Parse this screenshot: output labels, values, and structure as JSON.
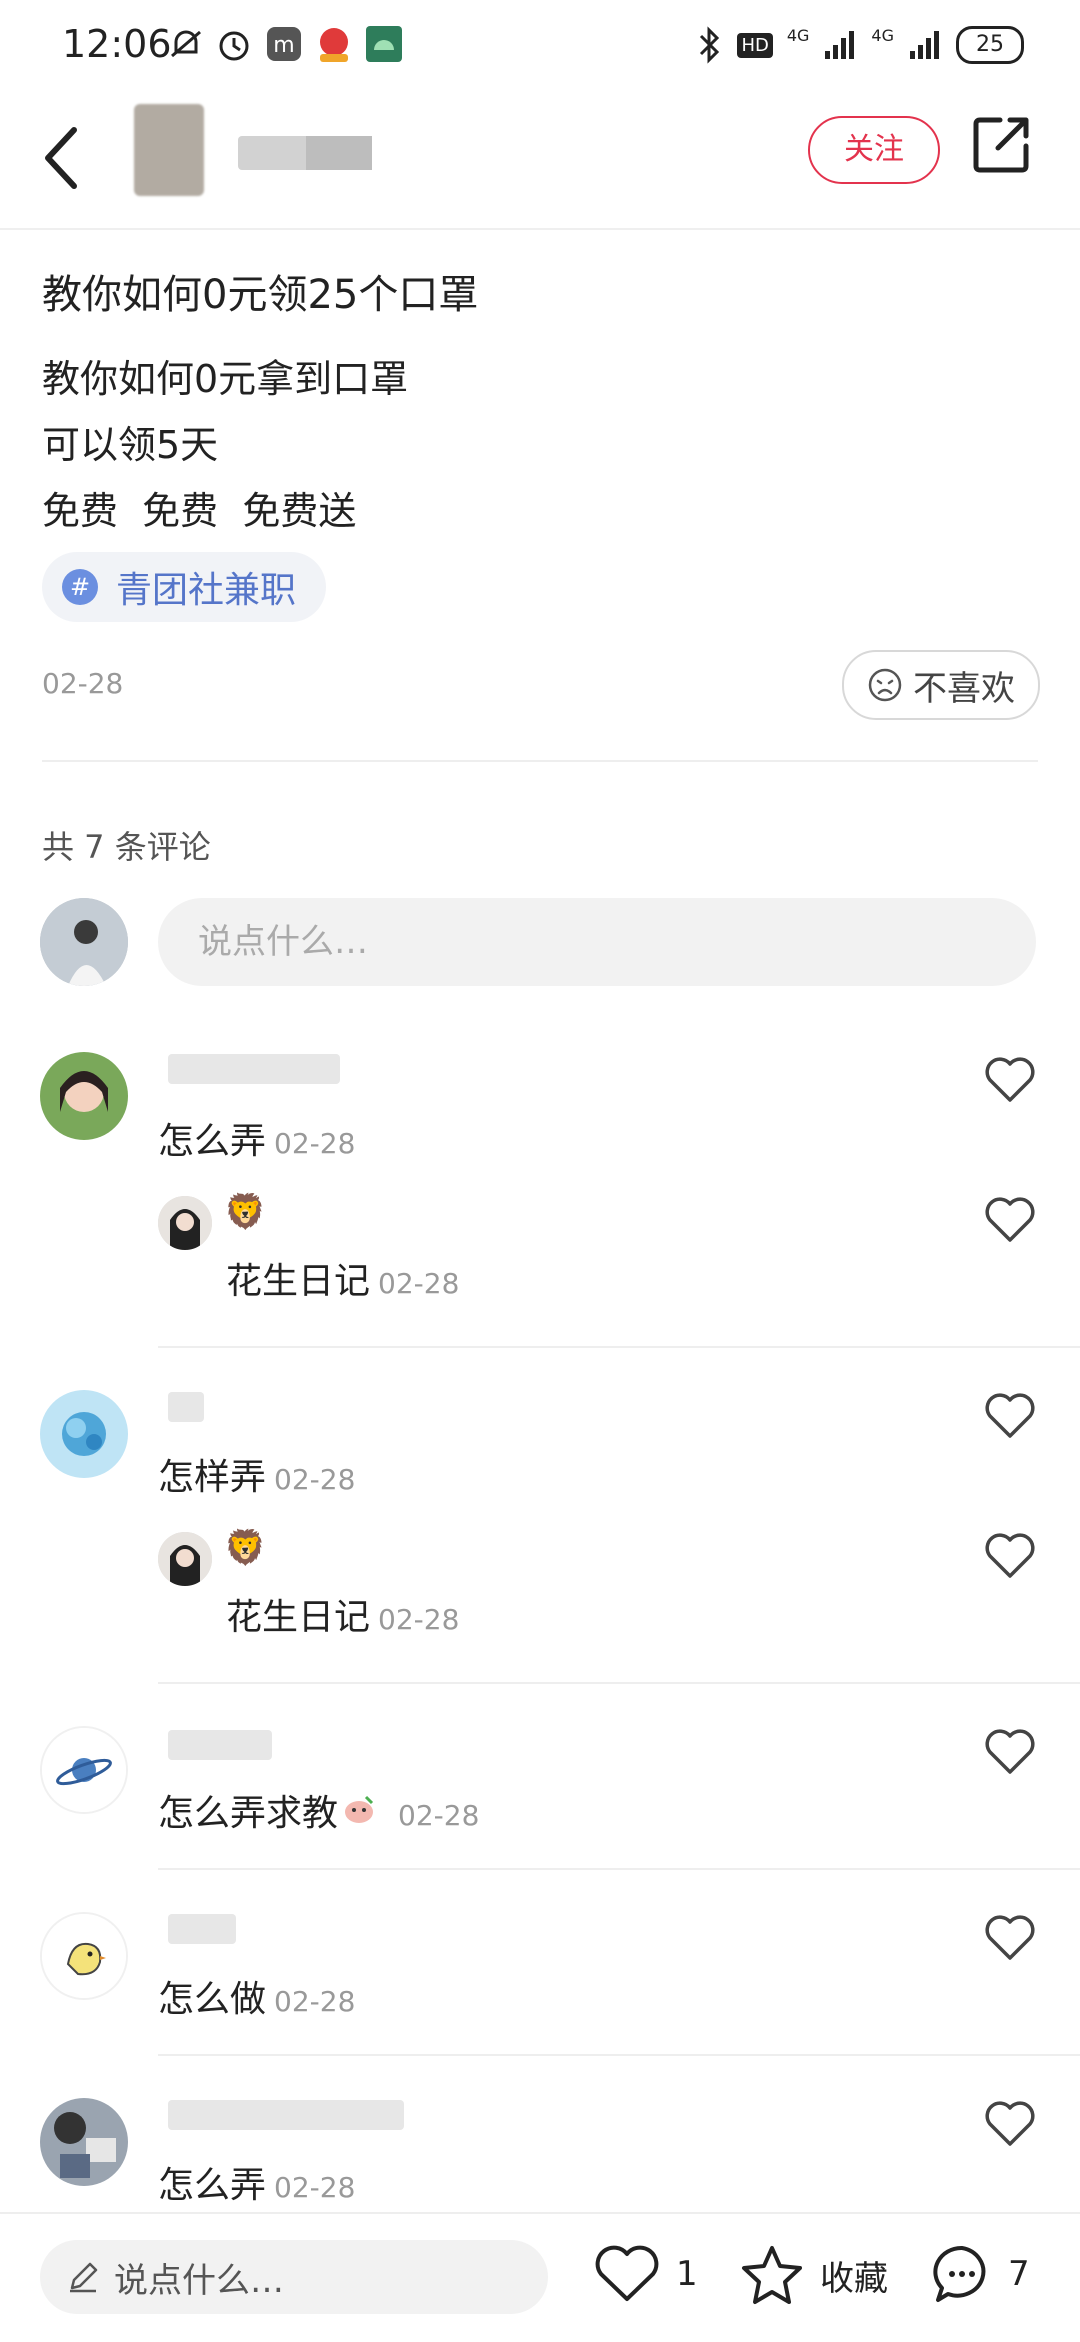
{
  "status_bar": {
    "time": "12:06",
    "battery": "25",
    "network1": "4G",
    "network2": "4G",
    "hd": "HD"
  },
  "header": {
    "follow_label": "关注"
  },
  "post": {
    "title": "教你如何0元领25个口罩",
    "lines": [
      "教你如何0元拿到口罩",
      "可以领5天",
      "免费  免费  免费送"
    ],
    "tag": "青团社兼职",
    "date": "02-28",
    "dislike_label": "不喜欢"
  },
  "comments_section": {
    "count_label": "共 7 条评论",
    "input_placeholder": "说点什么…",
    "comments": [
      {
        "text": "怎么弄",
        "date": "02-28",
        "reply": {
          "text": "花生日记",
          "date": "02-28"
        }
      },
      {
        "text": "怎样弄",
        "date": "02-28",
        "reply": {
          "text": "花生日记",
          "date": "02-28"
        }
      },
      {
        "text": "怎么弄求教",
        "date": "02-28"
      },
      {
        "text": "怎么做",
        "date": "02-28"
      },
      {
        "text": "怎么弄",
        "date": "02-28"
      }
    ]
  },
  "bottom_bar": {
    "input_placeholder": "说点什么…",
    "like_count": "1",
    "favorite_label": "收藏",
    "comment_count": "7"
  },
  "colors": {
    "accent": "#e3334d",
    "tag": "#5575c9"
  }
}
